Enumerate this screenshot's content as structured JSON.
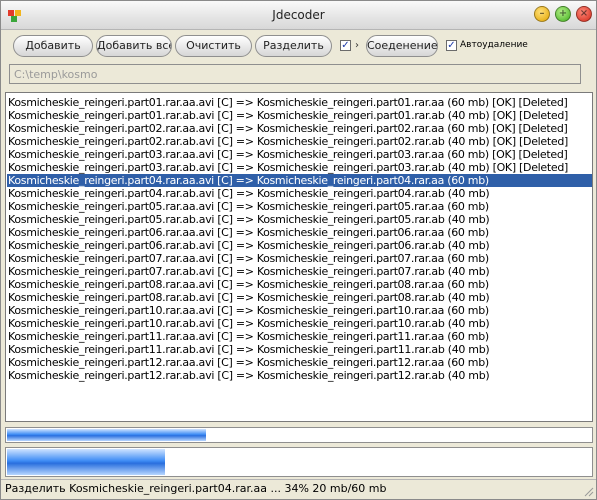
{
  "window": {
    "title": "Jdecoder"
  },
  "toolbar": {
    "add_label": "Добавить",
    "add_all_label": "Добавить всё",
    "clear_label": "Очистить",
    "split_label": "Разделить",
    "split_checked": true,
    "arrow": "›",
    "join_label": "Соеденение",
    "autodelete_checked": true,
    "autodelete_label": "Автоудаление",
    "path_value": "C:\\temp\\kosmo"
  },
  "list": {
    "selected_index": 6,
    "rows": [
      "Kosmicheskie_reingeri.part01.rar.aa.avi [C] => Kosmicheskie_reingeri.part01.rar.aa (60 mb) [OK] [Deleted]",
      "Kosmicheskie_reingeri.part01.rar.ab.avi [C] => Kosmicheskie_reingeri.part01.rar.ab (40 mb) [OK] [Deleted]",
      "Kosmicheskie_reingeri.part02.rar.aa.avi [C] => Kosmicheskie_reingeri.part02.rar.aa (60 mb) [OK] [Deleted]",
      "Kosmicheskie_reingeri.part02.rar.ab.avi [C] => Kosmicheskie_reingeri.part02.rar.ab (40 mb) [OK] [Deleted]",
      "Kosmicheskie_reingeri.part03.rar.aa.avi [C] => Kosmicheskie_reingeri.part03.rar.aa (60 mb) [OK] [Deleted]",
      "Kosmicheskie_reingeri.part03.rar.ab.avi [C] => Kosmicheskie_reingeri.part03.rar.ab (40 mb) [OK] [Deleted]",
      "Kosmicheskie_reingeri.part04.rar.aa.avi [C] => Kosmicheskie_reingeri.part04.rar.aa (60 mb)",
      "Kosmicheskie_reingeri.part04.rar.ab.avi [C] => Kosmicheskie_reingeri.part04.rar.ab (40 mb)",
      "Kosmicheskie_reingeri.part05.rar.aa.avi [C] => Kosmicheskie_reingeri.part05.rar.aa (60 mb)",
      "Kosmicheskie_reingeri.part05.rar.ab.avi [C] => Kosmicheskie_reingeri.part05.rar.ab (40 mb)",
      "Kosmicheskie_reingeri.part06.rar.aa.avi [C] => Kosmicheskie_reingeri.part06.rar.aa (60 mb)",
      "Kosmicheskie_reingeri.part06.rar.ab.avi [C] => Kosmicheskie_reingeri.part06.rar.ab (40 mb)",
      "Kosmicheskie_reingeri.part07.rar.aa.avi [C] => Kosmicheskie_reingeri.part07.rar.aa (60 mb)",
      "Kosmicheskie_reingeri.part07.rar.ab.avi [C] => Kosmicheskie_reingeri.part07.rar.ab (40 mb)",
      "Kosmicheskie_reingeri.part08.rar.aa.avi [C] => Kosmicheskie_reingeri.part08.rar.aa (60 mb)",
      "Kosmicheskie_reingeri.part08.rar.ab.avi [C] => Kosmicheskie_reingeri.part08.rar.ab (40 mb)",
      "Kosmicheskie_reingeri.part10.rar.aa.avi [C] => Kosmicheskie_reingeri.part10.rar.aa (60 mb)",
      "Kosmicheskie_reingeri.part10.rar.ab.avi [C] => Kosmicheskie_reingeri.part10.rar.ab (40 mb)",
      "Kosmicheskie_reingeri.part11.rar.aa.avi [C] => Kosmicheskie_reingeri.part11.rar.aa (60 mb)",
      "Kosmicheskie_reingeri.part11.rar.ab.avi [C] => Kosmicheskie_reingeri.part11.rar.ab (40 mb)",
      "Kosmicheskie_reingeri.part12.rar.aa.avi [C] => Kosmicheskie_reingeri.part12.rar.aa (60 mb)",
      "Kosmicheskie_reingeri.part12.rar.ab.avi [C] => Kosmicheskie_reingeri.part12.rar.ab (40 mb)"
    ]
  },
  "progress": {
    "overall_fraction": 0.34,
    "current_fraction": 0.27,
    "fill_color": "#3f8df5"
  },
  "status": {
    "text": "Разделить Kosmicheskie_reingeri.part04.rar.aa ... 34% 20 mb/60 mb"
  },
  "colors": {
    "selection": "#2f5fa8",
    "window_bg": "#ece9d8"
  }
}
